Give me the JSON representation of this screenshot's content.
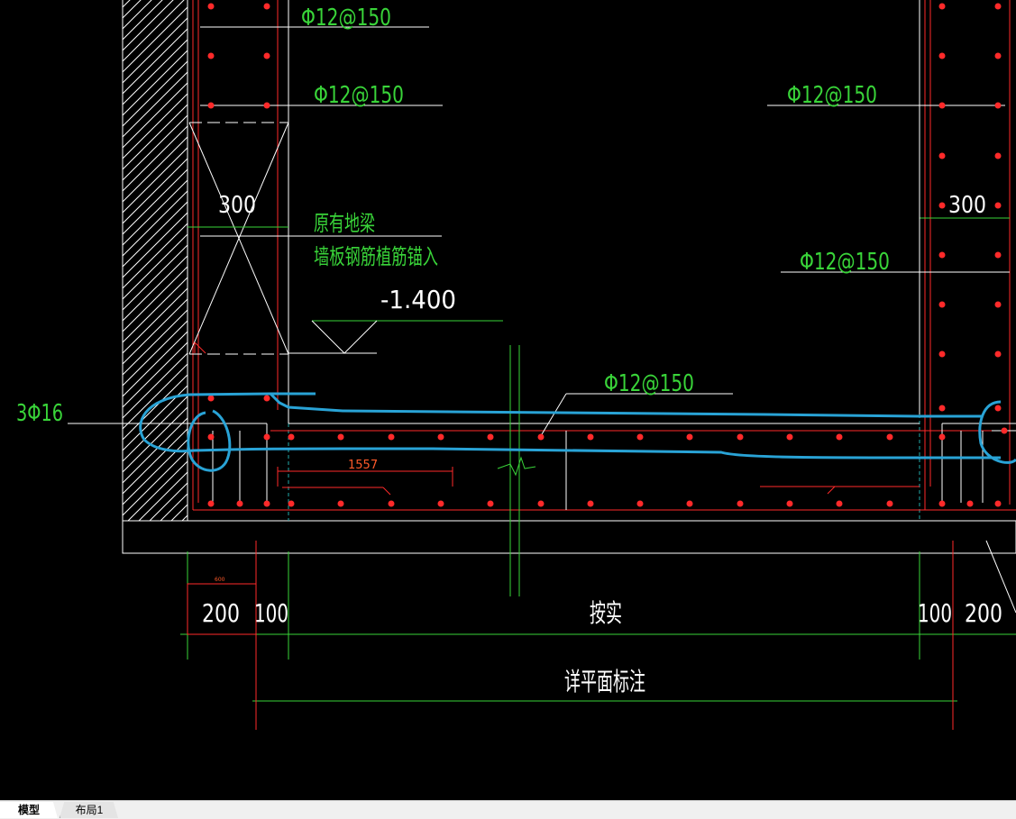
{
  "drawing": {
    "rebar_labels": [
      "Φ12@150",
      "Φ12@150",
      "Φ12@150",
      "Φ12@150",
      "Φ12@150"
    ],
    "left_rebar_label": "3Φ16",
    "dim_300_left": "300",
    "dim_300_right": "300",
    "note_line1": "原有地梁",
    "note_line2": "墙板钢筋植筋锚入",
    "elevation": "-1.400",
    "dim_1557": "1557",
    "dim_600": "600",
    "dim_200_left": "200",
    "dim_100_left": "100",
    "dim_press_actual": "按实",
    "dim_100_right": "100",
    "dim_200_right": "200",
    "dim_see_plan": "详平面标注"
  },
  "colors": {
    "background": "#000000",
    "line_white": "#ffffff",
    "line_red": "#ff2a2a",
    "text_green": "#39d439",
    "markup_blue": "#29a3d6"
  },
  "tabs": {
    "model": "模型",
    "layout1": "布局1"
  }
}
